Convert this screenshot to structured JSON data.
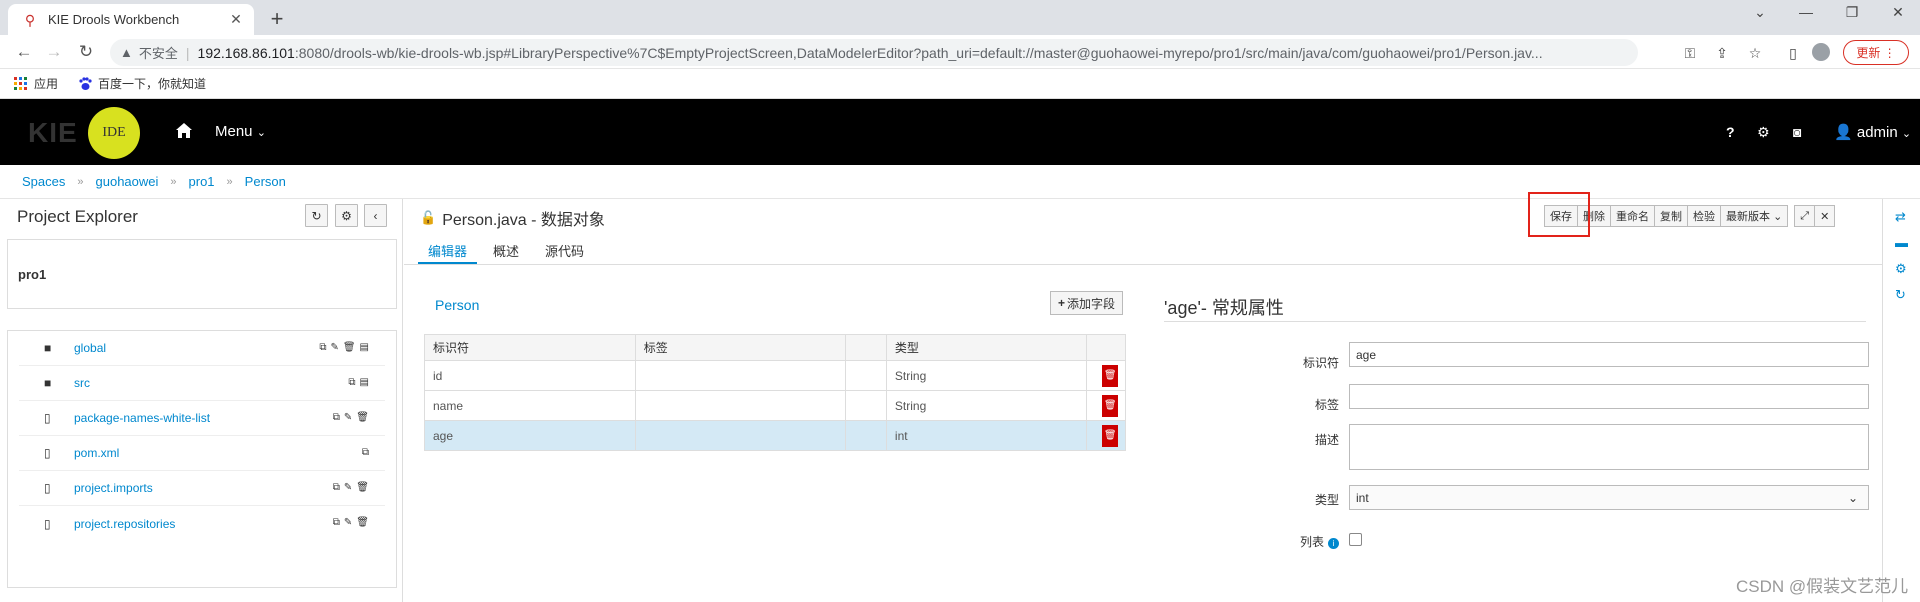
{
  "browser": {
    "tab_title": "KIE Drools Workbench",
    "insecure_label": "不安全",
    "url_host": "192.168.86.101",
    "url_path": ":8080/drools-wb/kie-drools-wb.jsp#LibraryPerspective%7C$EmptyProjectScreen,DataModelerEditor?path_uri=default://master@guohaowei-myrepo/pro1/src/main/java/com/guohaowei/pro1/Person.jav...",
    "update_label": "更新",
    "bookmarks": [
      "应用",
      "百度一下，你就知道"
    ]
  },
  "header": {
    "logo_text": "KIE",
    "ide_text": "IDE",
    "menu_label": "Menu",
    "user_label": "admin",
    "help_label": "?"
  },
  "breadcrumb": [
    "Spaces",
    "guohaowei",
    "pro1",
    "Person"
  ],
  "explorer": {
    "title": "Project Explorer",
    "project": "pro1",
    "files": [
      {
        "name": "global",
        "type": "folder"
      },
      {
        "name": "src",
        "type": "folder"
      },
      {
        "name": "package-names-white-list",
        "type": "file"
      },
      {
        "name": "pom.xml",
        "type": "file"
      },
      {
        "name": "project.imports",
        "type": "file"
      },
      {
        "name": "project.repositories",
        "type": "file"
      }
    ]
  },
  "editor": {
    "title": "Person.java - 数据对象",
    "toolbar": [
      "保存",
      "删除",
      "重命名",
      "复制",
      "检验",
      "最新版本"
    ],
    "tabs": [
      "编辑器",
      "概述",
      "源代码"
    ],
    "object_name": "Person",
    "add_field_label": "添加字段",
    "columns": [
      "标识符",
      "标签",
      "类型"
    ],
    "fields": [
      {
        "id": "id",
        "label": "",
        "type": "String"
      },
      {
        "id": "name",
        "label": "",
        "type": "String"
      },
      {
        "id": "age",
        "label": "",
        "type": "int"
      }
    ],
    "props": {
      "title": "'age'- 常规属性",
      "identifier_label": "标识符",
      "identifier_value": "age",
      "label_label": "标签",
      "label_value": "",
      "desc_label": "描述",
      "desc_value": "",
      "type_label": "类型",
      "type_value": "int",
      "list_label": "列表"
    }
  },
  "watermark": "CSDN @假装文艺范儿",
  "colors": {
    "accent": "#0088ce",
    "delete": "#cc0000",
    "highlight": "#e2231a",
    "ide": "#d8e11f"
  }
}
